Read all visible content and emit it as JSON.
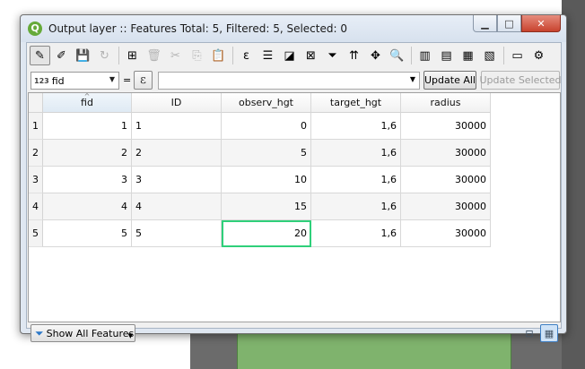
{
  "window": {
    "title": "Output layer :: Features Total: 5, Filtered: 5, Selected: 0",
    "app_icon_letter": "Q",
    "minimize_symbol": "▁",
    "maximize_symbol": "□",
    "close_symbol": "✕"
  },
  "toolbar": {
    "buttons": [
      {
        "name": "toggle-editing-icon",
        "glyph": "✎",
        "state": "active"
      },
      {
        "name": "toggle-multi-edit-icon",
        "glyph": "✐",
        "state": "normal"
      },
      {
        "name": "save-edits-icon",
        "glyph": "💾",
        "state": "normal"
      },
      {
        "name": "reload-icon",
        "glyph": "↻",
        "state": "disabled"
      },
      {
        "name": "add-feature-icon",
        "glyph": "⊞",
        "state": "normal"
      },
      {
        "name": "delete-selected-icon",
        "glyph": "🗑",
        "state": "disabled"
      },
      {
        "name": "cut-icon",
        "glyph": "✂",
        "state": "disabled"
      },
      {
        "name": "copy-icon",
        "glyph": "⎘",
        "state": "disabled"
      },
      {
        "name": "paste-icon",
        "glyph": "📋",
        "state": "normal"
      },
      {
        "name": "select-by-expression-icon",
        "glyph": "ε",
        "state": "normal"
      },
      {
        "name": "select-all-icon",
        "glyph": "☰",
        "state": "normal"
      },
      {
        "name": "invert-selection-icon",
        "glyph": "◪",
        "state": "normal"
      },
      {
        "name": "deselect-all-icon",
        "glyph": "⊠",
        "state": "normal"
      },
      {
        "name": "filter-icon",
        "glyph": "⏷",
        "state": "normal"
      },
      {
        "name": "move-selection-top-icon",
        "glyph": "⇈",
        "state": "normal"
      },
      {
        "name": "pan-to-selected-icon",
        "glyph": "✥",
        "state": "normal"
      },
      {
        "name": "zoom-to-selected-icon",
        "glyph": "🔍",
        "state": "normal"
      },
      {
        "name": "new-field-icon",
        "glyph": "▥",
        "state": "normal"
      },
      {
        "name": "delete-field-icon",
        "glyph": "▤",
        "state": "normal"
      },
      {
        "name": "field-calculator-icon",
        "glyph": "▦",
        "state": "normal"
      },
      {
        "name": "conditional-formatting-icon",
        "glyph": "▧",
        "state": "normal"
      },
      {
        "name": "dock-icon",
        "glyph": "▭",
        "state": "normal"
      },
      {
        "name": "actions-icon",
        "glyph": "⚙",
        "state": "normal"
      }
    ]
  },
  "expression_bar": {
    "field_type_label": "123",
    "field_value": "fid",
    "equals": "=",
    "expression_symbol": "ε",
    "expression_value": "",
    "update_all_label": "Update All",
    "update_selected_label": "Update Selected"
  },
  "table": {
    "columns": [
      "fid",
      "ID",
      "observ_hgt",
      "target_hgt",
      "radius"
    ],
    "sorted_column": "fid",
    "sort_indicator": "^",
    "rows": [
      {
        "header": "1",
        "cells": [
          "1",
          "1",
          "0",
          "1,6",
          "30000"
        ]
      },
      {
        "header": "2",
        "cells": [
          "2",
          "2",
          "5",
          "1,6",
          "30000"
        ]
      },
      {
        "header": "3",
        "cells": [
          "3",
          "3",
          "10",
          "1,6",
          "30000"
        ]
      },
      {
        "header": "4",
        "cells": [
          "4",
          "4",
          "15",
          "1,6",
          "30000"
        ]
      },
      {
        "header": "5",
        "cells": [
          "5",
          "5",
          "20",
          "1,6",
          "30000"
        ]
      }
    ],
    "focused_cell": {
      "row": 4,
      "col": 2
    }
  },
  "bottom_bar": {
    "show_all_label": "Show All Features",
    "form_view_glyph": "⊟",
    "table_view_glyph": "▦",
    "active_view": "table"
  }
}
